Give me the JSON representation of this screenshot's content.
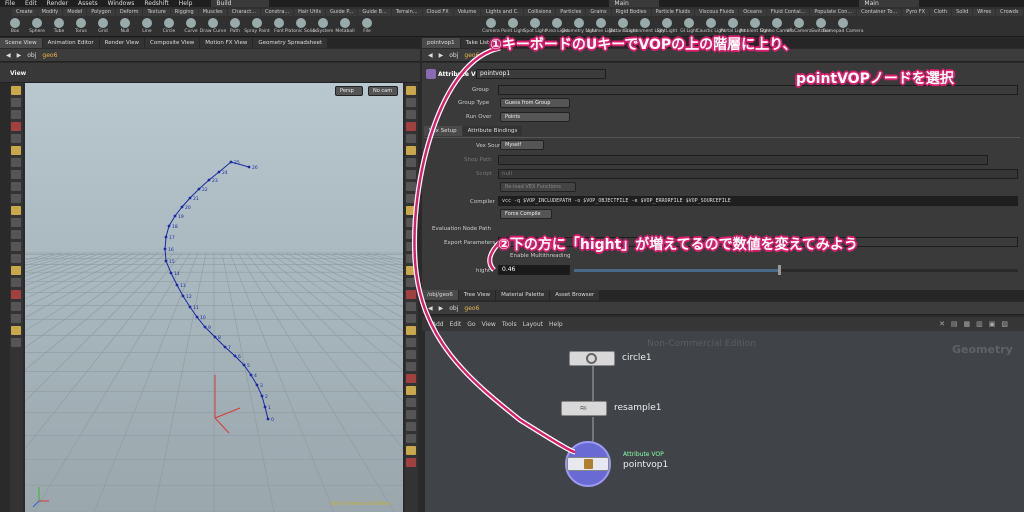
{
  "menubar": {
    "items": [
      "File",
      "Edit",
      "Render",
      "Assets",
      "Windows",
      "Redshift",
      "Help"
    ],
    "desktop": "Build",
    "desktop2": "Main",
    "desktop3": "Main"
  },
  "shelf_left": {
    "tabs": [
      "Create",
      "Modify",
      "Model",
      "Polygon",
      "Deform",
      "Texture",
      "Rigging",
      "Muscles",
      "Charact...",
      "Constra...",
      "Hair Utils",
      "Guide P...",
      "Guide B...",
      "Terrain...",
      "Cloud FX",
      "Volume",
      "Redshift"
    ],
    "tools": [
      "Box",
      "Sphere",
      "Tube",
      "Torus",
      "Grid",
      "Null",
      "Line",
      "Circle",
      "Curve",
      "Draw Curve",
      "Path",
      "Spray Paint",
      "Font",
      "Platonic Solids",
      "L-System",
      "Metaball",
      "File"
    ]
  },
  "shelf_right": {
    "tabs": [
      "Lights and C.",
      "Collisions",
      "Particles",
      "Grains",
      "Rigid Bodies",
      "Particle Fluids",
      "Viscous Fluids",
      "Oceans",
      "Fluid Contai...",
      "Populate Con...",
      "Container To...",
      "Pyro FX",
      "Cloth",
      "Solid",
      "Wires",
      "Crowds",
      "Drive Simul..."
    ],
    "tools": [
      "Camera",
      "Point Light",
      "Spot Light",
      "Area Light",
      "Geometry Light",
      "Volume Light",
      "Distant Light",
      "Environment Light",
      "Sky Light",
      "GI Light",
      "Caustic Light",
      "Portal Light",
      "Ambient Light",
      "Stereo Camera",
      "VR Camera",
      "Switcher",
      "Gamepad Camera"
    ]
  },
  "left_pane": {
    "tabs": [
      "Scene View",
      "Animation Editor",
      "Render View",
      "Composite View",
      "Motion FX View",
      "Geometry Spreadsheet"
    ],
    "path": [
      "obj",
      "geo6"
    ],
    "view_label": "View",
    "persp": "Persp",
    "cam": "No cam",
    "watermark": "Non-Commercial Edition",
    "point_numbers": [
      "0",
      "1",
      "2",
      "3",
      "4",
      "5",
      "6",
      "7",
      "8",
      "9",
      "10",
      "11",
      "12",
      "13",
      "14",
      "15",
      "16",
      "17",
      "18",
      "19",
      "20",
      "21",
      "22",
      "23",
      "24",
      "25",
      "26"
    ]
  },
  "param_pane": {
    "tabs": [
      "pointvop1",
      "Take List"
    ],
    "path": [
      "obj",
      "geo6"
    ],
    "node_type": "Attribute VOP",
    "node_name": "pointvop1",
    "group_label": "Group",
    "group_value": "",
    "group_type_label": "Group Type",
    "group_type_value": "Guess from Group",
    "run_over_label": "Run Over",
    "run_over_value": "Points",
    "subtabs": [
      "Vex Setup",
      "Attribute Bindings"
    ],
    "vex_source_label": "Vex Source",
    "vex_source_value": "Myself",
    "shop_path_label": "Shop Path",
    "script_label": "Script",
    "script_value": "null",
    "reload_button": "Re-load VEX Functions",
    "compiler_label": "Compiler",
    "compiler_value": "vcc -q $VOP_INCLUDEPATH -o $VOP_OBJECTFILE -e $VOP_ERRORFILE $VOP_SOURCEFILE",
    "force_compile": "Force Compile",
    "eval_node_path_label": "Evaluation Node Path",
    "export_params_label": "Export Parameters",
    "enable_mt": "Enable Multithreading",
    "hight_label": "hight",
    "hight_value": "0.46",
    "hight_fraction": 0.46
  },
  "network_pane": {
    "tabs": [
      "/obj/geo6",
      "Tree View",
      "Material Palette",
      "Asset Browser"
    ],
    "path": [
      "obj",
      "geo6"
    ],
    "menu": [
      "Add",
      "Edit",
      "Go",
      "View",
      "Tools",
      "Layout",
      "Help"
    ],
    "watermark": "Non-Commercial Edition",
    "context": "Geometry",
    "nodes": [
      {
        "name": "circle1",
        "type": ""
      },
      {
        "name": "resample1",
        "type": ""
      },
      {
        "name": "pointvop1",
        "type": "Attribute VOP"
      }
    ]
  },
  "annotations": {
    "line1": "①キーボードのUキーでVOPの上の階層に上り、",
    "line2": "pointVOPノードを選択",
    "line3": "②下の方に「hight」が増えてるので数値を変えてみよう"
  },
  "colors": {
    "annotation_stroke": "#d81f6e",
    "curve": "#1a2aa0",
    "selected_node": "#7a7adc"
  }
}
